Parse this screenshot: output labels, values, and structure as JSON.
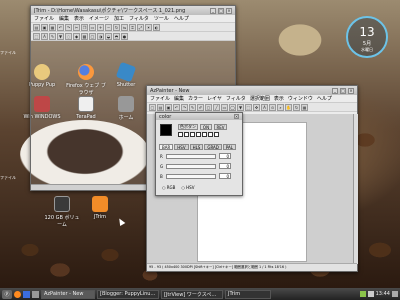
{
  "desktop": {
    "icons": [
      {
        "label": "Puppy Pup"
      },
      {
        "label": "Firefox ウェブ ブラウザ"
      },
      {
        "label": "Shutter"
      },
      {
        "label": "Win WINDOWS"
      },
      {
        "label": "TeraPad"
      },
      {
        "label": "ホーム"
      },
      {
        "label": "120 GB ボリューム"
      },
      {
        "label": "JTrim"
      }
    ],
    "edge_labels": {
      "left_top": "ファイル",
      "left_mid": "ファイル"
    },
    "clock": {
      "hour": "13",
      "date": "5月",
      "day": "水曜日"
    }
  },
  "jtrim": {
    "title": "JTrim - D:\\Home\\Wasakasu\\ポクチャ\\ワークスペース 1_021.png",
    "menu": [
      "ファイル",
      "編集",
      "表示",
      "イメージ",
      "加工",
      "フィルタ",
      "ツール",
      "ヘルプ"
    ]
  },
  "azpainter": {
    "title": "AzPainter - New",
    "menu": [
      "ファイル",
      "編集",
      "カラー",
      "レイヤ",
      "フィルタ",
      "選択範囲",
      "表示",
      "ウィンドウ",
      "ヘルプ"
    ],
    "status": "95 - 93   ( 450x400 300DPI  [Shift+キー] [Ctrl+キー] 範囲選択と範囲 1 / 1  Fits 18'16 )"
  },
  "color_panel": {
    "title": "color",
    "buttons": [
      "色ボタン",
      "ON",
      "REV"
    ],
    "tabs": [
      "BAR",
      "HSV",
      "HLS",
      "GRAD",
      "PAL"
    ],
    "rows": [
      {
        "label": "R",
        "value": "0"
      },
      {
        "label": "G",
        "value": "0"
      },
      {
        "label": "B",
        "value": "0"
      }
    ],
    "modes": [
      "RGB",
      "HSV"
    ]
  },
  "taskbar": {
    "start": "Ⓟ",
    "tasks": [
      "AzPainter - New",
      "[Blogger: PuppyLinu…",
      "[JtrView] ワークスペ…",
      "JTrim"
    ],
    "time": "13:44"
  },
  "colors": {
    "accent": "#6cc3e8",
    "titlebar": "#c8c8c8"
  }
}
